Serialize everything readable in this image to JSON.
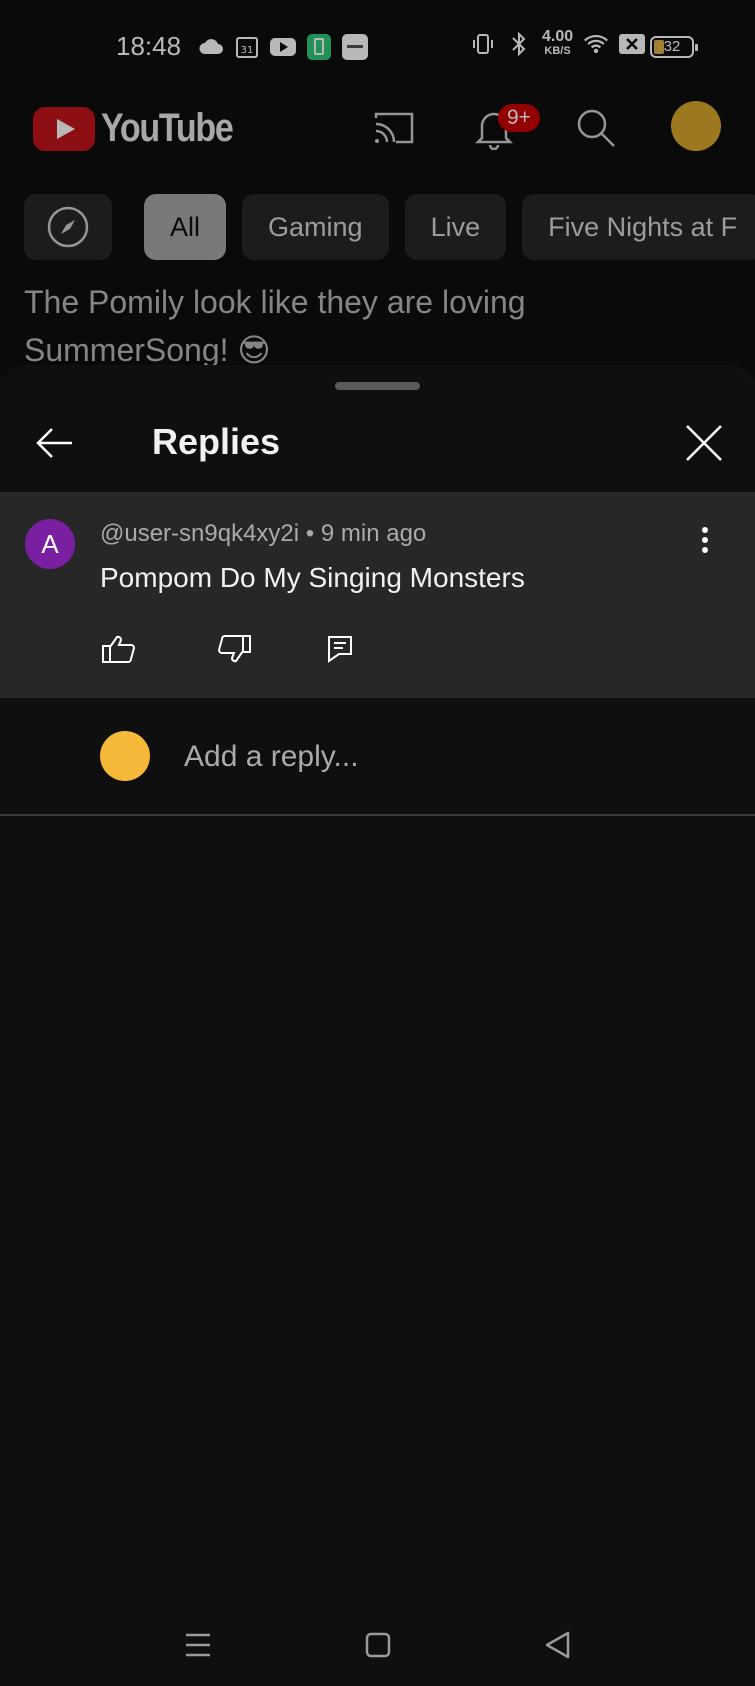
{
  "status_bar": {
    "time": "18:48",
    "speed_value": "4.00",
    "speed_unit": "KB/S",
    "battery_level": "32",
    "icons": [
      "cloud-icon",
      "calendar-31-icon",
      "youtube-icon",
      "battery-saver-icon",
      "app-icon",
      "vibrate-icon",
      "bluetooth-icon",
      "wifi-icon",
      "no-sim-icon",
      "battery-icon"
    ]
  },
  "header": {
    "logo_text": "YouTube",
    "notification_badge": "9+",
    "icons": [
      "cast-icon",
      "bell-icon",
      "search-icon",
      "avatar"
    ]
  },
  "chips": {
    "items": [
      "All",
      "Gaming",
      "Live",
      "Five Nights at F"
    ],
    "active": "All"
  },
  "background_caption": "The Pomily look like they are loving SummerSong! 😎",
  "sheet": {
    "title": "Replies"
  },
  "comment": {
    "avatar_letter": "A",
    "author": "@user-sn9qk4xy2i",
    "separator": " • ",
    "time": "9 min ago",
    "text": "Pompom Do My Singing Monsters"
  },
  "reply": {
    "placeholder": "Add a reply..."
  },
  "colors": {
    "background": "#0f0f0f",
    "comment_background": "#272727",
    "youtube_red": "#c4161c",
    "comment_avatar": "#7b1fa2",
    "badge_red": "#cc0000"
  }
}
